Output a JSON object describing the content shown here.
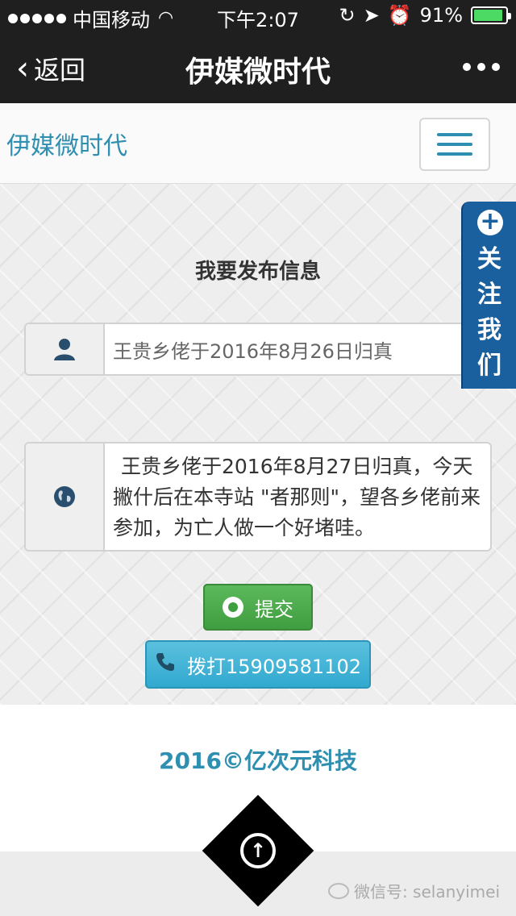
{
  "status_bar": {
    "carrier": "中国移动",
    "time": "下午2:07",
    "battery_percent": "91%",
    "battery_level": 0.91
  },
  "nav": {
    "back_label": "返回",
    "title": "伊媒微时代"
  },
  "site": {
    "brand": "伊媒微时代",
    "accent_color": "#2f8fb0"
  },
  "form": {
    "heading": "我要发布信息",
    "title_value": "王贵乡佬于2016年8月26日归真",
    "content_value": "王贵乡佬于2016年8月27日归真，今天撇什后在本寺站 \"者那则\"，望各乡佬前来参加，为亡人做一个好堵哇。",
    "submit_label": "提交",
    "call_label": "拨打15909581102"
  },
  "follow_tab": {
    "chars": [
      "关",
      "注",
      "我",
      "们"
    ],
    "color": "#1a5f9e"
  },
  "footer": {
    "copyright": "2016©亿次元科技"
  },
  "watermark": {
    "text": "微信号: selanyimei"
  }
}
